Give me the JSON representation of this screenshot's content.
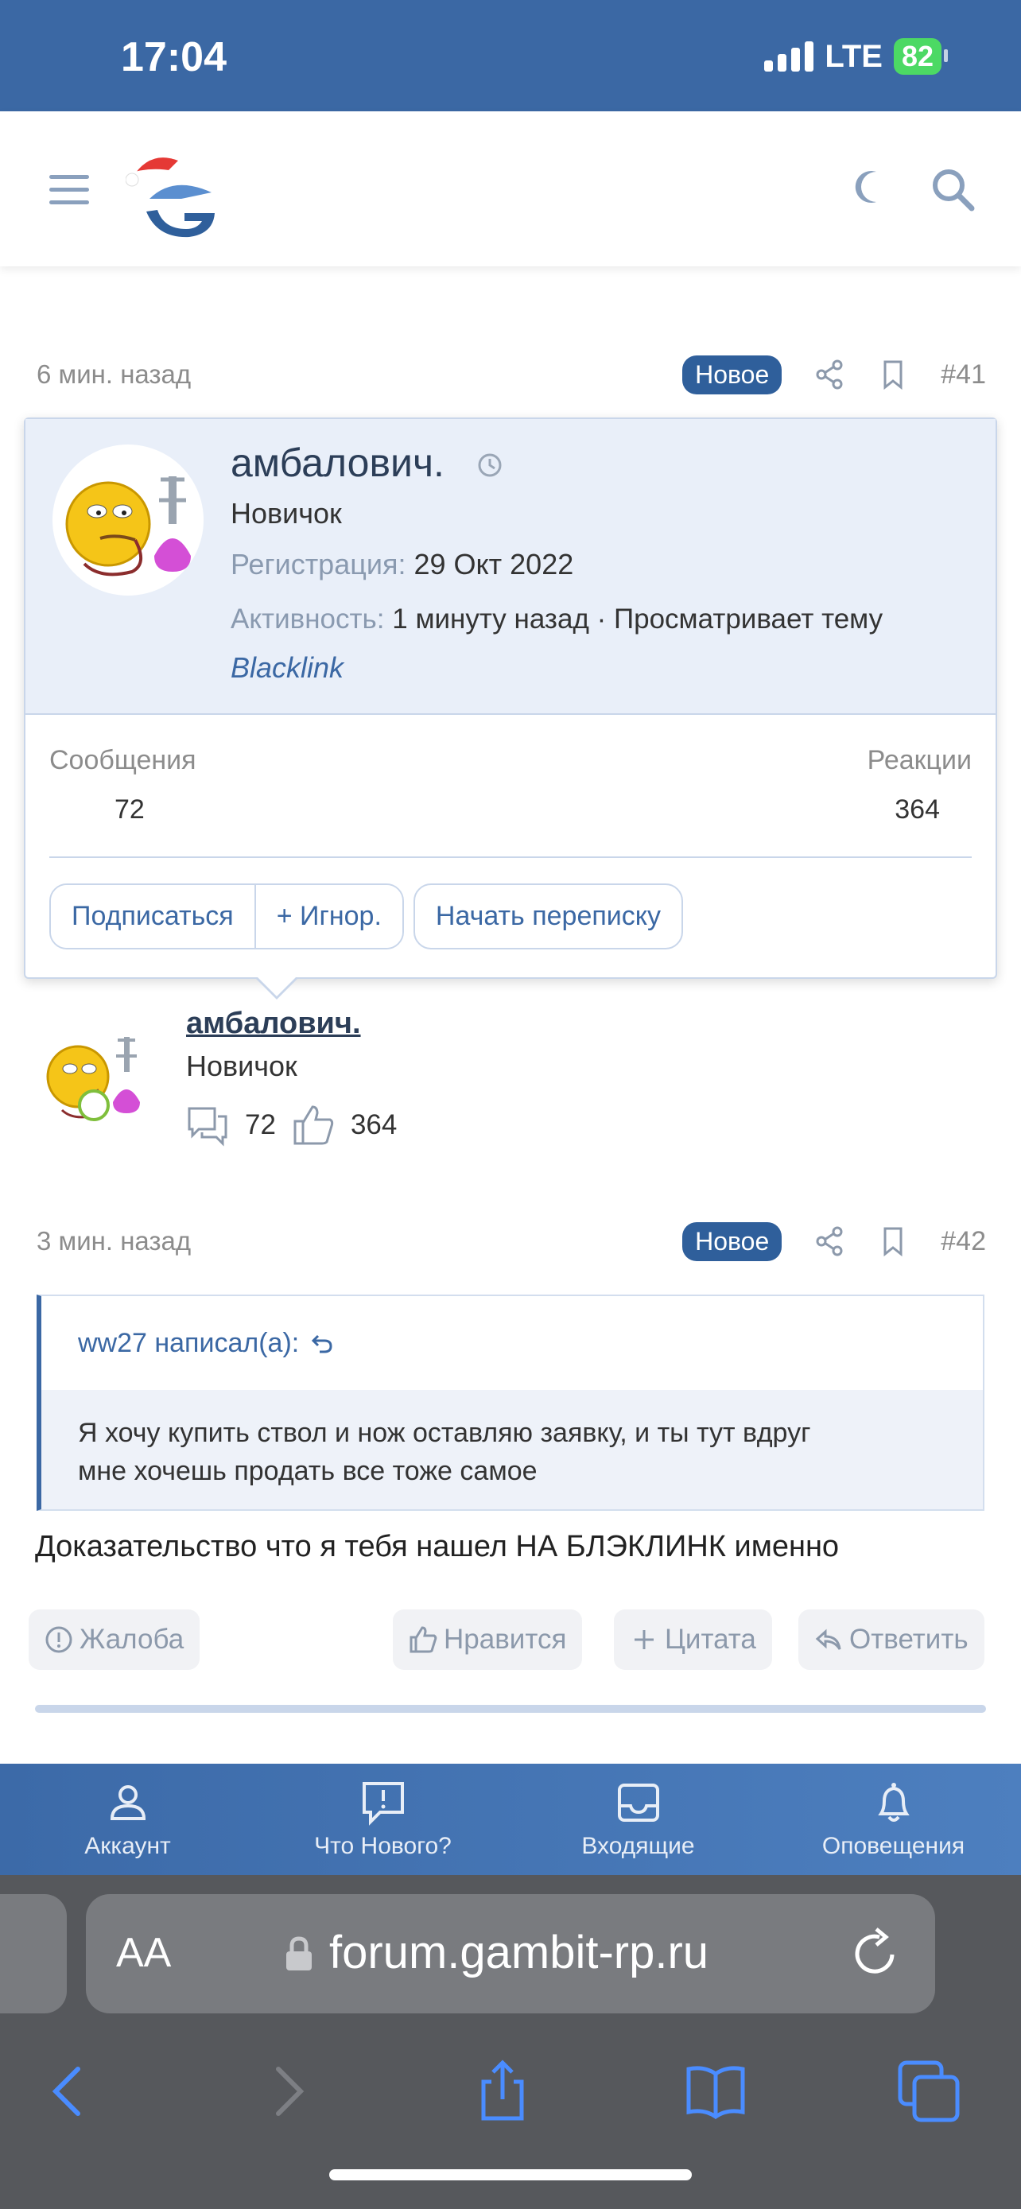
{
  "status_bar": {
    "time": "17:04",
    "network": "LTE",
    "battery": "82"
  },
  "header": {
    "menu_icon": "hamburger-icon",
    "logo_icon": "gambit-logo",
    "theme_icon": "moon-icon",
    "search_icon": "search-icon"
  },
  "post41": {
    "time": "6 мин. назад",
    "badge": "Новое",
    "number": "#41"
  },
  "tooltip": {
    "name": "амбалович.",
    "rank": "Новичок",
    "reg_label": "Регистрация:",
    "reg_value": "29 Окт 2022",
    "act_label": "Активность:",
    "act_value": "1 минуту назад · Просматривает тему",
    "act_link": "Blacklink",
    "messages_label": "Сообщения",
    "messages_value": "72",
    "reactions_label": "Реакции",
    "reactions_value": "364",
    "btn_follow": "Подписаться",
    "btn_ignore": "+ Игнор.",
    "btn_message": "Начать переписку"
  },
  "user": {
    "name": "амбалович.",
    "rank": "Новичок",
    "messages": "72",
    "reactions": "364"
  },
  "post42": {
    "time": "3 мин. назад",
    "badge": "Новое",
    "number": "#42",
    "quote_author": "ww27 написал(а):",
    "quote_line1": "Я хочу купить ствол и нож оставляю заявку, и ты тут вдруг",
    "quote_line2": "мне хочешь продать все тоже самое",
    "text": "Доказательство что я тебя нашел НА БЛЭКЛИНК именно",
    "report": "Жалоба",
    "like": "Нравится",
    "quote": "Цитата",
    "reply": "Ответить"
  },
  "bottom_nav": [
    {
      "label": "Аккаунт",
      "icon": "account-icon"
    },
    {
      "label": "Что Нового?",
      "icon": "whats-new-icon"
    },
    {
      "label": "Входящие",
      "icon": "inbox-icon"
    },
    {
      "label": "Оповещения",
      "icon": "bell-icon"
    }
  ],
  "browser": {
    "aa": "AA",
    "url": "forum.gambit-rp.ru"
  },
  "colors": {
    "brand_blue": "#3b68a4",
    "badge_blue": "#2f5f9b"
  }
}
